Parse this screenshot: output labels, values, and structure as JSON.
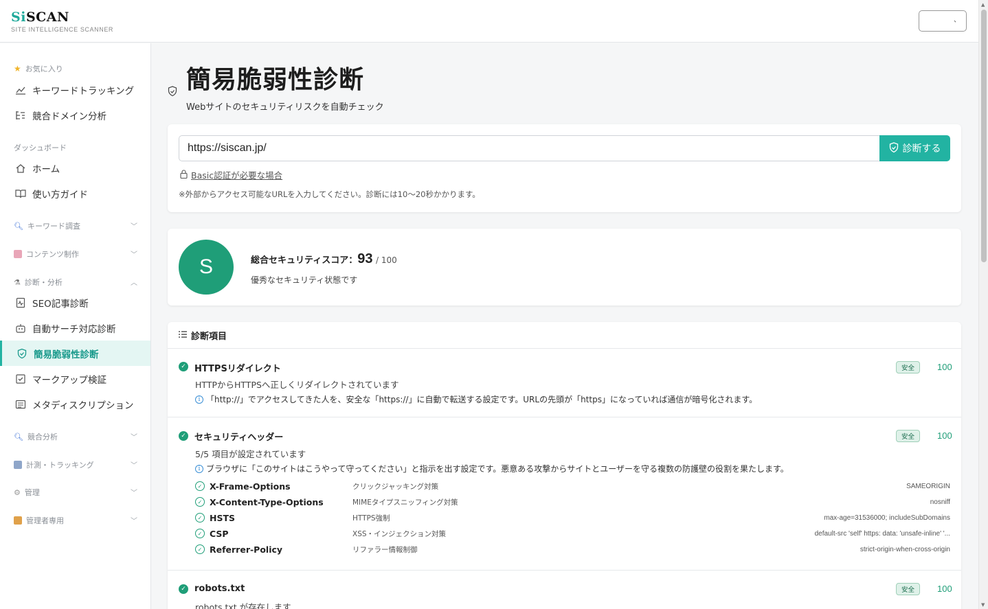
{
  "header": {
    "logo_prefix": "Si",
    "logo_rest": "SCAN",
    "logo_sub": "SITE INTELLIGENCE SCANNER",
    "user_menu": "、"
  },
  "sidebar": {
    "favorites_label": "お気に入り",
    "fav_items": [
      "キーワードトラッキング",
      "競合ドメイン分析"
    ],
    "dashboard_label": "ダッシュボード",
    "dash_items": [
      "ホーム",
      "使い方ガイド"
    ],
    "groups": {
      "keyword": "キーワード調査",
      "content": "コンテンツ制作",
      "diagnosis": "診断・分析",
      "competitor": "競合分析",
      "tracking": "計測・トラッキング",
      "admin": "管理",
      "superadmin": "管理者専用"
    },
    "diag_items": [
      "SEO記事診断",
      "自動サーチ対応診断",
      "簡易脆弱性診断",
      "マークアップ検証",
      "メタディスクリプション"
    ]
  },
  "page": {
    "title": "簡易脆弱性診断",
    "subtitle": "Webサイトのセキュリティリスクを自動チェック"
  },
  "form": {
    "url_value": "https://siscan.jp/",
    "button_label": "診断する",
    "basic_auth_link": "Basic認証が必要な場合",
    "note": "※外部からアクセス可能なURLを入力してください。診断には10〜20秒かかります。"
  },
  "score": {
    "grade": "S",
    "label": "総合セキュリティスコア：",
    "value": "93",
    "max": "/ 100",
    "message": "優秀なセキュリティ状態です"
  },
  "checks": {
    "heading": "診断項目",
    "items": [
      {
        "title": "HTTPSリダイレクト",
        "status": "安全",
        "points": "100",
        "desc": "HTTPからHTTPSへ正しくリダイレクトされています",
        "info": "「http://」でアクセスしてきた人を、安全な「https://」に自動で転送する設定です。URLの先頭が「https」になっていれば通信が暗号化されます。"
      },
      {
        "title": "セキュリティヘッダー",
        "status": "安全",
        "points": "100",
        "desc": "5/5 項目が設定されています",
        "info": "ブラウザに「このサイトはこうやって守ってください」と指示を出す設定です。悪意ある攻撃からサイトとユーザーを守る複数の防護壁の役割を果たします。",
        "headers": [
          {
            "name": "X-Frame-Options",
            "desc": "クリックジャッキング対策",
            "value": "SAMEORIGIN"
          },
          {
            "name": "X-Content-Type-Options",
            "desc": "MIMEタイプスニッフィング対策",
            "value": "nosniff"
          },
          {
            "name": "HSTS",
            "desc": "HTTPS強制",
            "value": "max-age=31536000; includeSubDomains"
          },
          {
            "name": "CSP",
            "desc": "XSS・インジェクション対策",
            "value": "default-src 'self' https: data: 'unsafe-inline' '..."
          },
          {
            "name": "Referrer-Policy",
            "desc": "リファラー情報制御",
            "value": "strict-origin-when-cross-origin"
          }
        ]
      },
      {
        "title": "robots.txt",
        "status": "安全",
        "points": "100",
        "desc": "robots.txt が存在します"
      }
    ]
  },
  "colors": {
    "accent": "#22b3a2",
    "score_green": "#1f9e78",
    "active_bg": "#e4f6f3"
  }
}
